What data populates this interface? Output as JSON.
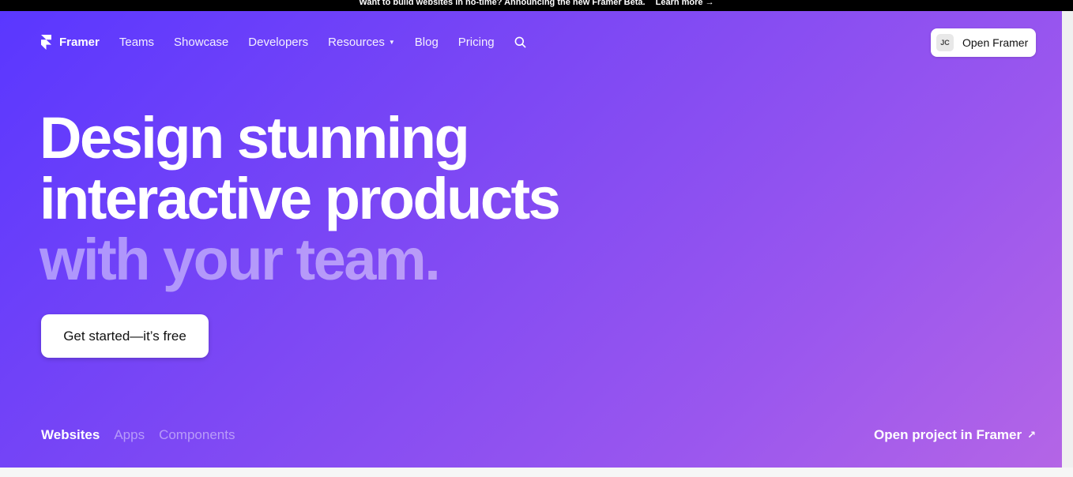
{
  "announcement": {
    "message": "Want to build websites in no-time? Announcing the new Framer Beta.",
    "link_label": "Learn more →"
  },
  "nav": {
    "brand": "Framer",
    "items": [
      {
        "label": "Teams"
      },
      {
        "label": "Showcase"
      },
      {
        "label": "Developers"
      },
      {
        "label": "Resources",
        "has_dropdown": true
      },
      {
        "label": "Blog"
      },
      {
        "label": "Pricing"
      }
    ],
    "search_icon": "search-icon",
    "open_button": {
      "avatar_initials": "JC",
      "label": "Open Framer"
    }
  },
  "hero": {
    "headline_line1": "Design stunning",
    "headline_line2": "interactive products",
    "headline_line3": "with your team.",
    "cta_label": "Get started—it’s free",
    "gradient_start": "#5a37ff",
    "gradient_end": "#b465e6"
  },
  "tabs": [
    {
      "label": "Websites",
      "active": true
    },
    {
      "label": "Apps",
      "active": false
    },
    {
      "label": "Components",
      "active": false
    }
  ],
  "open_project": {
    "label": "Open project in Framer",
    "icon": "arrow-up-right-icon"
  }
}
